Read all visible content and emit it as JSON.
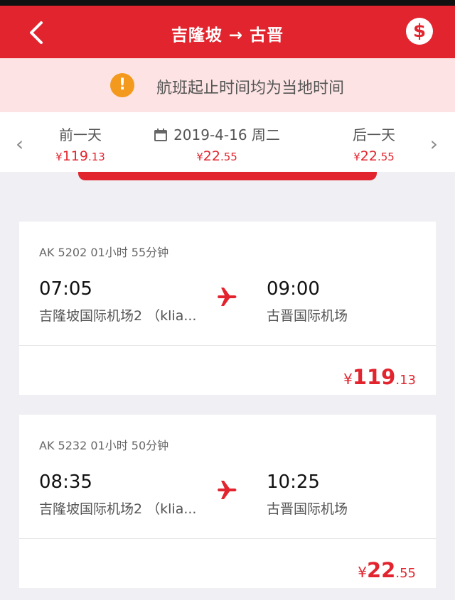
{
  "header": {
    "title": "吉隆坡 → 古晋",
    "currency_symbol": "$"
  },
  "notice": {
    "text": "航班起止时间均为当地时间",
    "icon": "!"
  },
  "date_bar": {
    "prev": {
      "label": "前一天",
      "currency": "¥",
      "price_int": "119",
      "price_dec": ".13"
    },
    "current": {
      "date": "2019-4-16 周二",
      "currency": "¥",
      "price_int": "22",
      "price_dec": ".55"
    },
    "next": {
      "label": "后一天",
      "currency": "¥",
      "price_int": "22",
      "price_dec": ".55"
    }
  },
  "flights": [
    {
      "meta": "AK 5202  01小时 55分钟",
      "dep_time": "07:05",
      "dep_airport": "吉隆坡国际机场2 （klia...",
      "arr_time": "09:00",
      "arr_airport": "古晋国际机场",
      "currency": "¥",
      "price_int": "119",
      "price_dec": ".13"
    },
    {
      "meta": "AK 5232  01小时 50分钟",
      "dep_time": "08:35",
      "dep_airport": "吉隆坡国际机场2 （klia...",
      "arr_time": "10:25",
      "arr_airport": "古晋国际机场",
      "currency": "¥",
      "price_int": "22",
      "price_dec": ".55"
    }
  ],
  "colors": {
    "brand": "#e2242e",
    "warning": "#f39a1e",
    "notice_bg": "#fde3e3"
  }
}
